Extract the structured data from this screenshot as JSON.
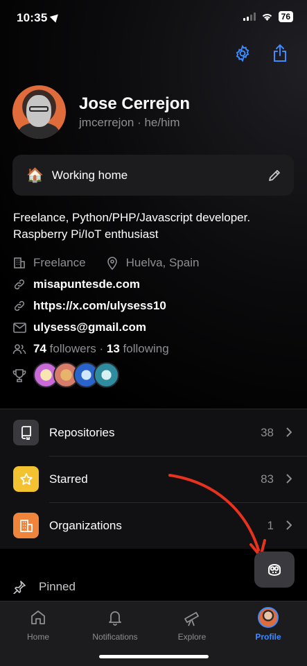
{
  "status_bar": {
    "time": "10:35",
    "battery": "76"
  },
  "profile": {
    "name": "Jose Cerrejon",
    "handle": "jmcerrejon · he/him",
    "status_emoji": "🏠",
    "status_text": "Working home",
    "bio": "Freelance, Python/PHP/Javascript developer. Raspberry Pi/IoT enthusiast",
    "company": "Freelance",
    "location": "Huelva, Spain",
    "website": "misapuntesde.com",
    "social": "https://x.com/ulysess10",
    "email": "ulysess@gmail.com",
    "followers_count": "74",
    "followers_label": "followers",
    "separator": "·",
    "following_count": "13",
    "following_label": "following"
  },
  "menu": [
    {
      "label": "Repositories",
      "count": "38",
      "color": "#3a3a3e"
    },
    {
      "label": "Starred",
      "count": "83",
      "color": "#f2c230"
    },
    {
      "label": "Organizations",
      "count": "1",
      "color": "#f0843a"
    }
  ],
  "pinned": {
    "label": "Pinned"
  },
  "tabs": [
    {
      "label": "Home"
    },
    {
      "label": "Notifications"
    },
    {
      "label": "Explore"
    },
    {
      "label": "Profile"
    }
  ],
  "colors": {
    "accent": "#3d8bff",
    "annotation_arrow": "#e8321f"
  }
}
